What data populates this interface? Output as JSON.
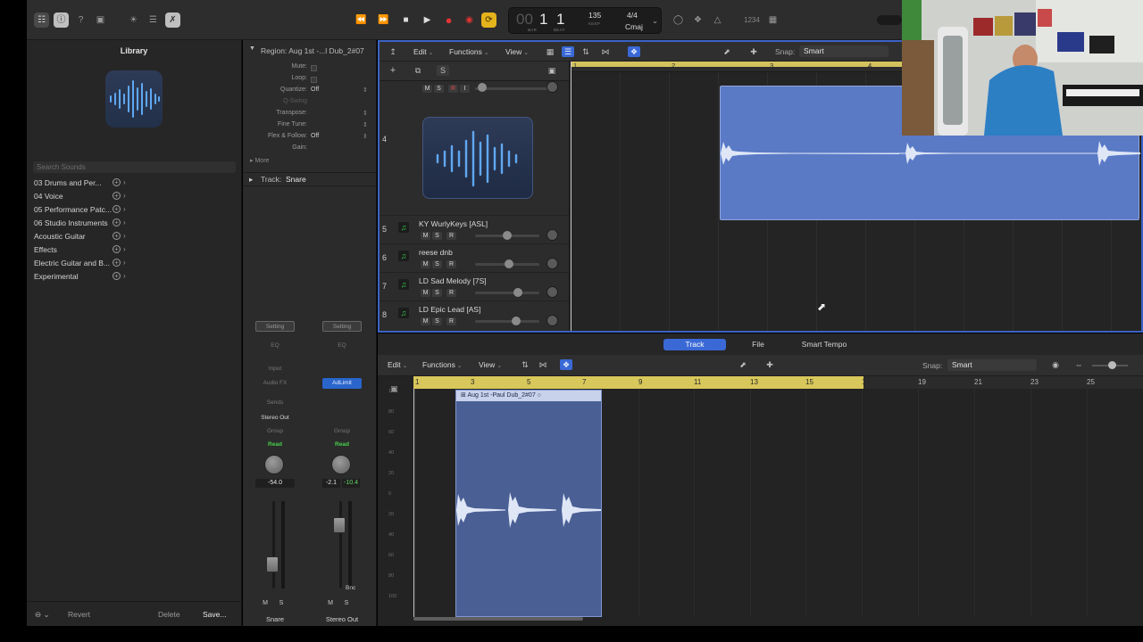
{
  "control_bar": {
    "lcd": {
      "bar": "1",
      "beat": "1",
      "bar_label": "BAR",
      "beat_label": "BEAT",
      "tempo": "135",
      "tempo_label": "KEEP",
      "signature": "4/4",
      "key": "Cmaj"
    },
    "cpu_label": "1234"
  },
  "library": {
    "title": "Library",
    "search_placeholder": "Search Sounds",
    "items": [
      "03 Drums and Per...",
      "04 Voice",
      "05 Performance Patc...",
      "06 Studio Instruments",
      "Acoustic Guitar",
      "Effects",
      "Electric Guitar and B...",
      "Experimental"
    ],
    "footer": {
      "revert": "Revert",
      "delete": "Delete",
      "save": "Save..."
    }
  },
  "inspector": {
    "region_title": "Region: Aug 1st -...l Dub_2#07",
    "rows": [
      {
        "key": "Mute:",
        "value": ""
      },
      {
        "key": "Loop:",
        "value": ""
      },
      {
        "key": "Quantize:",
        "value": "Off"
      },
      {
        "key": "Q-Swing",
        "value": ""
      },
      {
        "key": "Transpose:",
        "value": ""
      },
      {
        "key": "Fine Tune:",
        "value": ""
      },
      {
        "key": "Flex & Follow:",
        "value": "Off"
      },
      {
        "key": "Gain:",
        "value": ""
      }
    ],
    "more_label": "More",
    "track_label": "Track:",
    "track_name": "Snare",
    "strips": [
      {
        "setting": "Setting",
        "eq": "EQ",
        "input": "Input",
        "audio_fx": "Audio FX",
        "sends": "Sends",
        "output": "Stereo Out",
        "group": "Group",
        "automation": "Read",
        "volume": "-54.0",
        "peak": "",
        "mute": "M",
        "solo": "S",
        "name": "Snare",
        "fader_level": 0.28
      },
      {
        "setting": "Setting",
        "eq": "EQ",
        "input": "",
        "audio_fx": "AdLimit",
        "sends": "",
        "output": "",
        "group": "Group",
        "automation": "Read",
        "volume": "-2.1",
        "peak": "-10.4",
        "mute": "M",
        "solo": "S",
        "name": "Stereo Out",
        "fader_level": 0.72,
        "bnc": "Bnc"
      }
    ]
  },
  "tracks": {
    "menus": {
      "edit": "Edit",
      "functions": "Functions",
      "view": "View"
    },
    "snap_label": "Snap:",
    "snap_value": "Smart",
    "s_button": "S",
    "headers": [
      {
        "num": "4",
        "name": ""
      },
      {
        "num": "5",
        "name": "KY WurlyKeys [ASL]",
        "m": "M",
        "s": "S",
        "r": "R"
      },
      {
        "num": "6",
        "name": "reese dnb",
        "m": "M",
        "s": "S",
        "r": "R"
      },
      {
        "num": "7",
        "name": "LD Sad Melody [7S]",
        "m": "M",
        "s": "S",
        "r": "R"
      },
      {
        "num": "8",
        "name": "LD Epic Lead [AS]",
        "m": "M",
        "s": "S",
        "r": "R"
      }
    ],
    "track4_buttons": {
      "m": "M",
      "s": "S",
      "r": "R",
      "i": "I"
    },
    "ruler_bars": [
      "1",
      "2",
      "3",
      "4"
    ]
  },
  "editor": {
    "tabs": [
      "Track",
      "File",
      "Smart Tempo"
    ],
    "active_tab": "Track",
    "menus": {
      "edit": "Edit",
      "functions": "Functions",
      "view": "View"
    },
    "snap_label": "Snap:",
    "snap_value": "Smart",
    "ruler_bars": [
      "1",
      "3",
      "5",
      "7",
      "9",
      "11",
      "13",
      "15",
      "17",
      "19",
      "21",
      "23",
      "25"
    ],
    "region_name": "Aug 1st -Paul Dub_2#07",
    "scale": [
      "100",
      "80",
      "60",
      "40",
      "20",
      "0",
      "20",
      "40",
      "60",
      "80",
      "100"
    ]
  },
  "colors": {
    "accent": "#3a69d6",
    "region": "#5a7ac6",
    "cycle": "#d4c25e",
    "record": "#e23434",
    "loop": "#e5b31c",
    "read": "#47d14b"
  }
}
